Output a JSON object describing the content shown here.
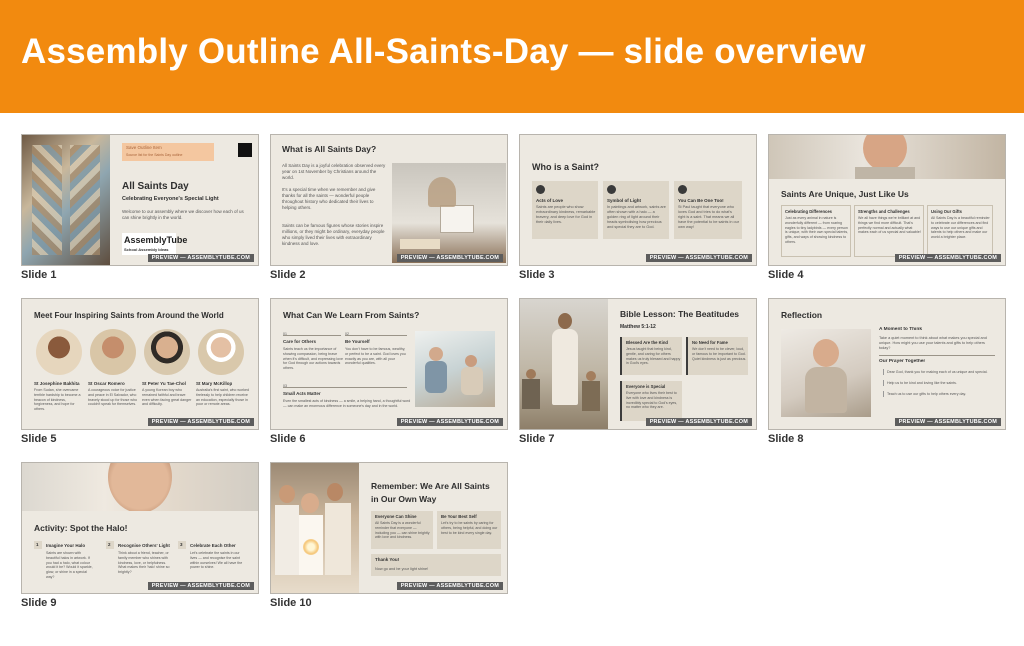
{
  "header": {
    "title": "Assembly Outline All-Saints-Day — slide overview"
  },
  "preview_badge": "PREVIEW — ASSEMBLYTUBE.COM",
  "slides": [
    {
      "caption": "Slide 1",
      "tag": "Save Outline Item",
      "tag_sub": "Source list for the Saints Day outline",
      "title": "All Saints Day",
      "subtitle": "Celebrating Everyone's Special Light",
      "body": "Welcome to our assembly where we discover how each of us can shine brightly in the world.",
      "logo_main": "AssemblyTube",
      "logo_sub": "School Assembly Ideas"
    },
    {
      "caption": "Slide 2",
      "title": "What is All Saints Day?",
      "p1": "All Saints Day is a joyful celebration observed every year on 1st November by Christians around the world.",
      "p2": "It's a special time when we remember and give thanks for all the saints — wonderful people throughout history who dedicated their lives to helping others.",
      "p3": "Saints can be famous figures whose stories inspire millions, or they might be ordinary, everyday people who simply lived their lives with extraordinary kindness and love."
    },
    {
      "caption": "Slide 3",
      "title": "Who is a Saint?",
      "cols": [
        {
          "heading": "Acts of Love",
          "text": "Saints are people who show extraordinary kindness, remarkable bravery, and deep love for God in their daily lives."
        },
        {
          "heading": "Symbol of Light",
          "text": "In paintings and artwork, saints are often shown with a halo — a golden ring of light around their heads symbolising how precious and special they are to God."
        },
        {
          "heading": "You Can Be One Too!",
          "text": "St Paul taught that everyone who loves God and tries to do what's right is a saint. That means we all have the potential to be saints in our own way!"
        }
      ]
    },
    {
      "caption": "Slide 4",
      "title": "Saints Are Unique, Just Like Us",
      "cols": [
        {
          "heading": "Celebrating Differences",
          "text": "Just as every animal in nature is wonderfully different — from roaring eagles to tiny ladybirds — every person is unique, with their own special talents, gifts, and ways of showing kindness to others."
        },
        {
          "heading": "Strengths and Challenges",
          "text": "We all have things we're brilliant at and things we find more difficult. That's perfectly normal and actually what makes each of us special and valuable!"
        },
        {
          "heading": "Using Our Gifts",
          "text": "All Saints Day is a beautiful reminder to celebrate our differences and find ways to use our unique gifts and talents to help others and make our world a brighter place."
        }
      ]
    },
    {
      "caption": "Slide 5",
      "title": "Meet Four Inspiring Saints from Around the World",
      "saints": [
        {
          "name": "St Josephine Bakhita",
          "text": "From Sudan, she overcame terrible hardship to become a beacon of kindness, forgiveness, and hope for others."
        },
        {
          "name": "St Oscar Romero",
          "text": "A courageous voice for justice and peace in El Salvador, who bravely stood up for those who couldn't speak for themselves."
        },
        {
          "name": "St Peter Yu Tae-Chol",
          "text": "A young Korean boy who remained faithful and brave even when facing great danger and difficulty."
        },
        {
          "name": "St Mary McKillop",
          "text": "Australia's first saint, who worked tirelessly to help children receive an education, especially those in poor or remote areas."
        }
      ]
    },
    {
      "caption": "Slide 6",
      "title": "What Can We Learn From Saints?",
      "items": [
        {
          "num": "01",
          "heading": "Care for Others",
          "text": "Saints teach us the importance of showing compassion, being brave when it's difficult, and expressing love for God through our actions towards others."
        },
        {
          "num": "02",
          "heading": "Be Yourself",
          "text": "You don't have to be famous, wealthy, or perfect to be a saint. God loves you exactly as you are, with all your wonderful qualities."
        },
        {
          "num": "03",
          "heading": "Small Acts Matter",
          "text": "Even the smallest acts of kindness — a smile, a helping hand, a thoughtful word — can make an enormous difference in someone's day and in the world."
        }
      ]
    },
    {
      "caption": "Slide 7",
      "title": "Bible Lesson: The Beatitudes",
      "ref": "Matthew 5:1-12",
      "boxes": [
        {
          "heading": "Blessed Are the Kind",
          "text": "Jesus taught that being kind, gentle, and caring for others makes us truly blessed and happy in God's eyes."
        },
        {
          "heading": "No Need for Fame",
          "text": "We don't need to be clever, loud, or famous to be important to God. Quiet kindness is just as precious."
        },
        {
          "heading": "Everyone is Special",
          "text": "Everyone who lives their best to live with love and kindness is incredibly special to God's eyes, no matter who they are."
        }
      ]
    },
    {
      "caption": "Slide 8",
      "title": "Reflection",
      "moment_heading": "A Moment to Think",
      "moment_text": "Take a quiet moment to think about what makes you special and unique. How might you use your talents and gifts to help others today?",
      "prayer_heading": "Our Prayer Together",
      "prayer_lines": [
        "Dear God, thank you for making each of us unique and special.",
        "Help us to be kind and loving like the saints.",
        "Teach us to use our gifts to help others every day."
      ]
    },
    {
      "caption": "Slide 9",
      "title": "Activity: Spot the Halo!",
      "steps": [
        {
          "num": "1",
          "heading": "Imagine Your Halo",
          "text": "Saints are shown with beautiful halos in artwork. If you had a halo, what colour would it be? Would it sparkle, glow, or shine in a special way?"
        },
        {
          "num": "2",
          "heading": "Recognise Others' Light",
          "text": "Think about a friend, teacher, or family member who shines with kindness, love, or helpfulness. What makes their 'halo' shine so brightly?"
        },
        {
          "num": "3",
          "heading": "Celebrate Each Other",
          "text": "Let's celebrate the saints in our lives — and recognise the saint within ourselves! We all have the power to shine."
        }
      ]
    },
    {
      "caption": "Slide 10",
      "title_line1": "Remember: We Are All Saints",
      "title_line2": "in Our Own Way",
      "boxes": [
        {
          "heading": "Everyone Can Shine",
          "text": "All Saints Day is a wonderful reminder that everyone — including you — can shine brightly with love and kindness."
        },
        {
          "heading": "Be Your Best Self",
          "text": "Let's try to be saints by caring for others, being helpful, and doing our best to be kind every single day."
        }
      ],
      "thanks_heading": "Thank You!",
      "thanks_text": "Now go and be your light shine!"
    }
  ],
  "colors": {
    "banner": "#f28a0f",
    "slide_bg": "#ede9e1",
    "box": "#ddd6c8"
  }
}
